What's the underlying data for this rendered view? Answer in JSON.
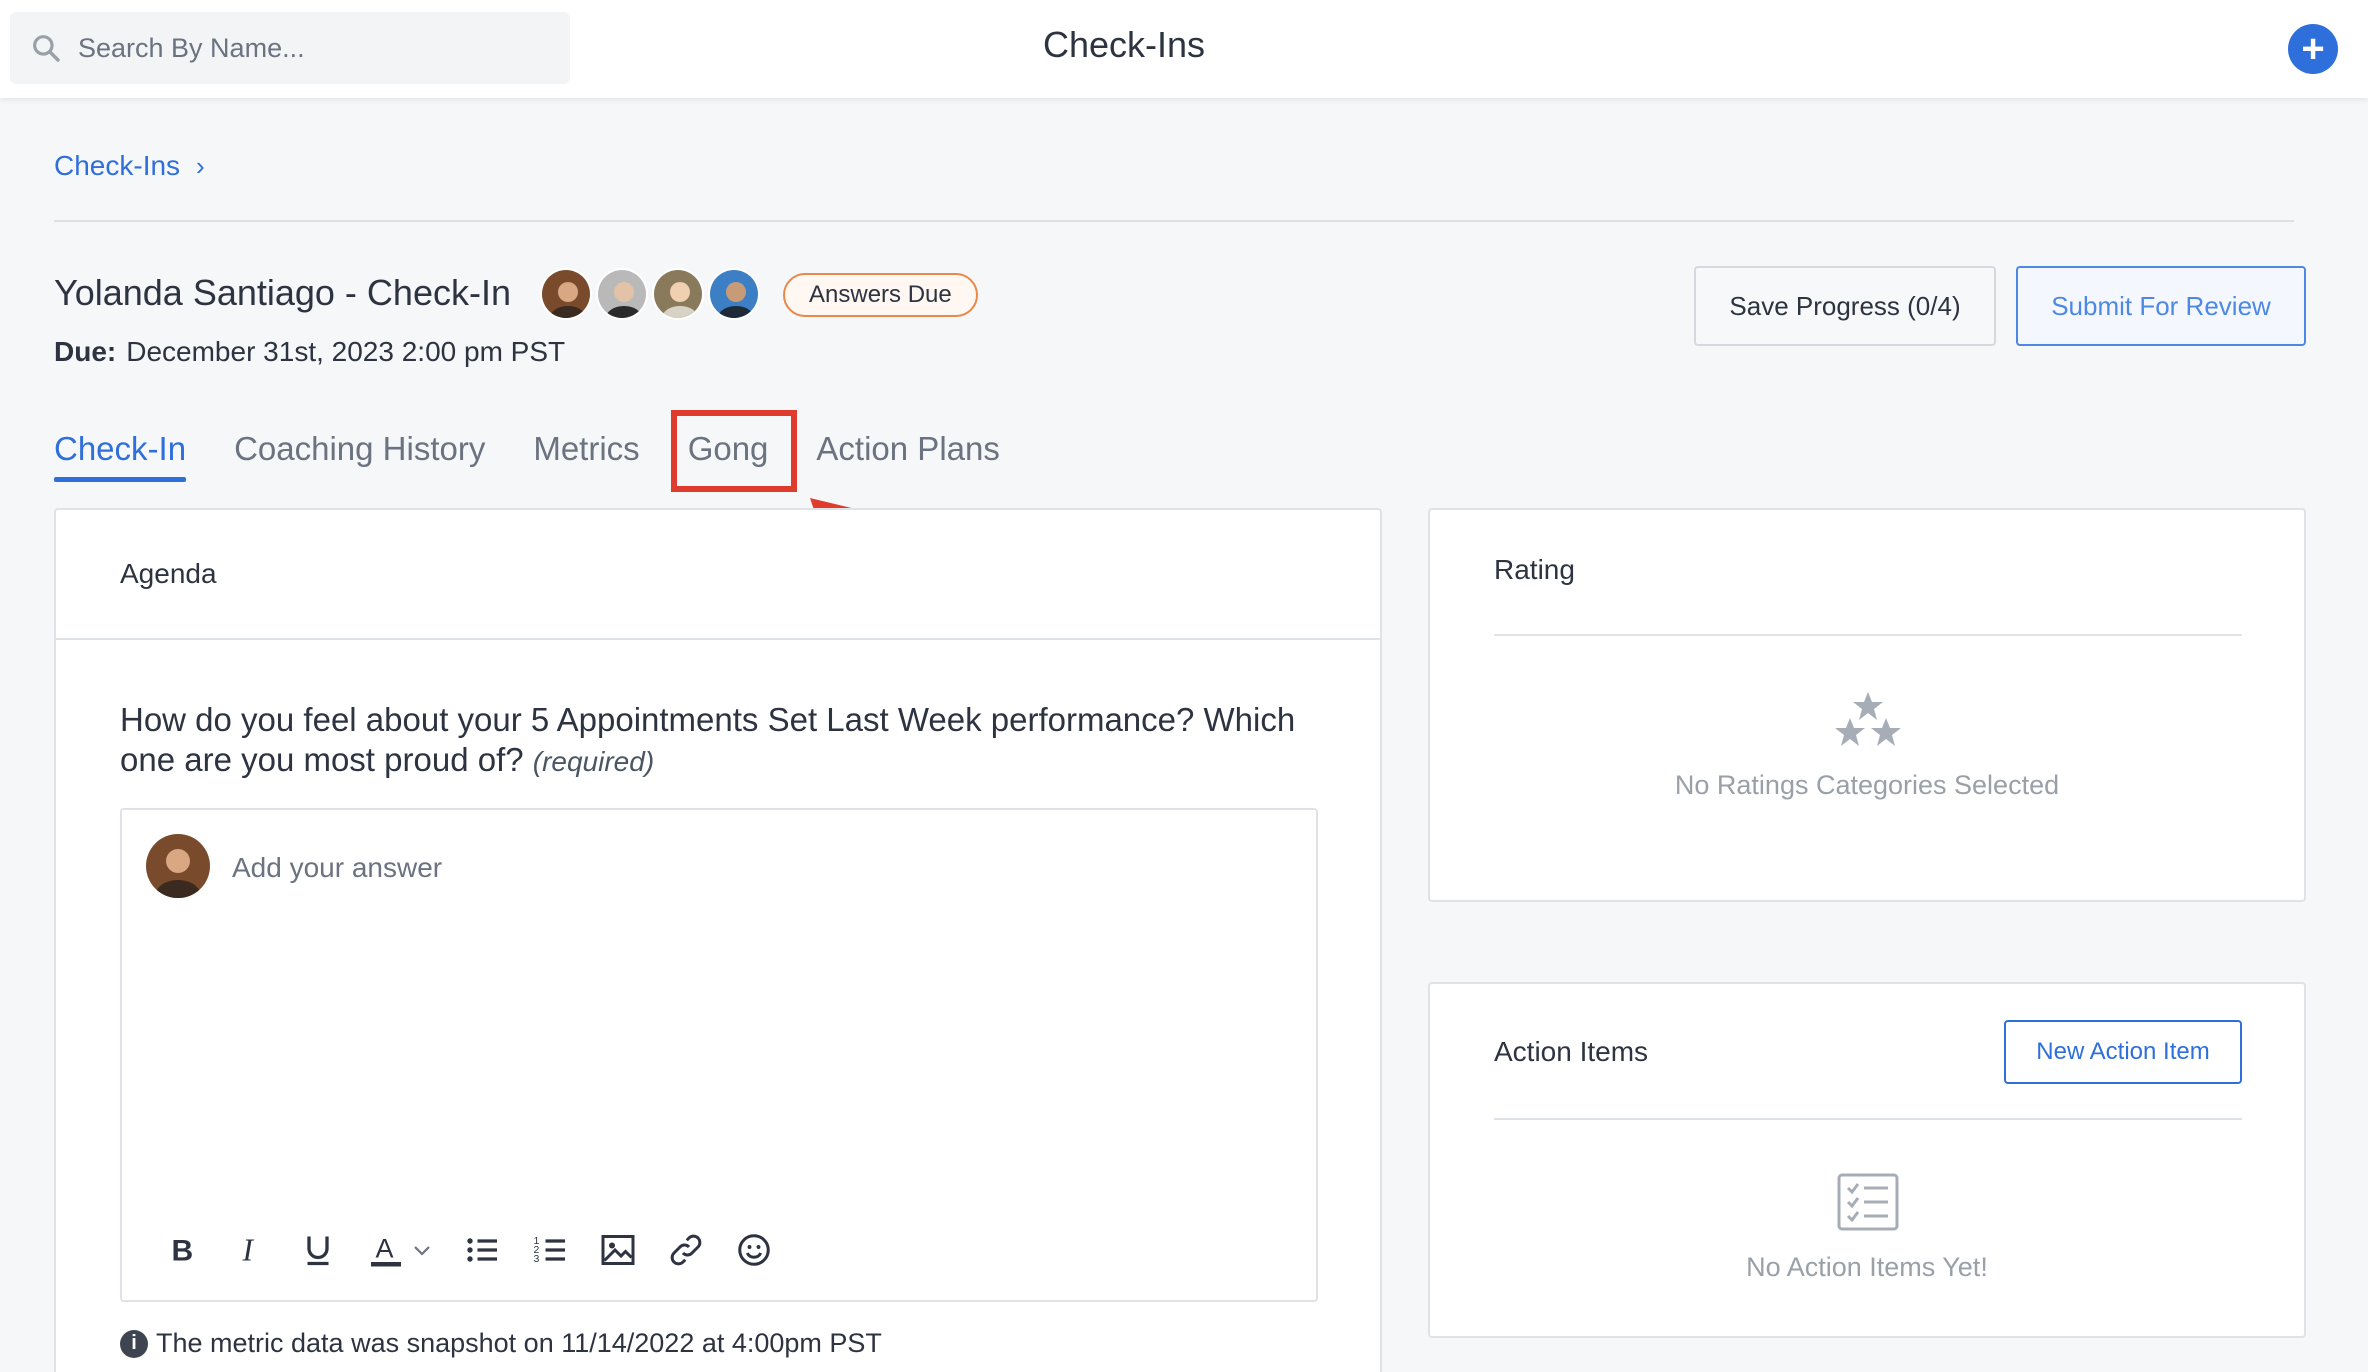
{
  "header": {
    "search_placeholder": "Search By Name...",
    "title": "Check-Ins",
    "add_label": "+"
  },
  "breadcrumb": {
    "label": "Check-Ins",
    "chevron": "›"
  },
  "checkin": {
    "title": "Yolanda Santiago - Check-In",
    "status_badge": "Answers Due",
    "due_label": "Due:",
    "due_value": "December 31st, 2023 2:00 pm PST",
    "avatars": [
      "avatar-1",
      "avatar-2",
      "avatar-3",
      "avatar-4"
    ]
  },
  "actions": {
    "save_label": "Save Progress (0/4)",
    "submit_label": "Submit For Review"
  },
  "tabs": [
    {
      "label": "Check-In",
      "active": true
    },
    {
      "label": "Coaching History",
      "active": false
    },
    {
      "label": "Metrics",
      "active": false
    },
    {
      "label": "Gong",
      "active": false
    },
    {
      "label": "Action Plans",
      "active": false
    }
  ],
  "agenda": {
    "heading": "Agenda",
    "question": "How do you feel about your 5 Appointments Set Last Week performance? Which one are you most proud of?",
    "required": "(required)",
    "answer_placeholder": "Add your answer",
    "toolbar": [
      "bold-icon",
      "italic-icon",
      "underline-icon",
      "text-color-icon",
      "chevron-down-icon",
      "bullet-list-icon",
      "numbered-list-icon",
      "image-icon",
      "link-icon",
      "emoji-icon"
    ],
    "snapshot_note": "The metric data was snapshot on 11/14/2022 at 4:00pm PST"
  },
  "rating": {
    "heading": "Rating",
    "empty_text": "No Ratings Categories Selected"
  },
  "action_items": {
    "heading": "Action Items",
    "new_label": "New Action Item",
    "empty_text": "No Action Items Yet!"
  },
  "colors": {
    "accent": "#2f6fdb",
    "highlight": "#e03c2e",
    "badge_border": "#e8884a"
  }
}
